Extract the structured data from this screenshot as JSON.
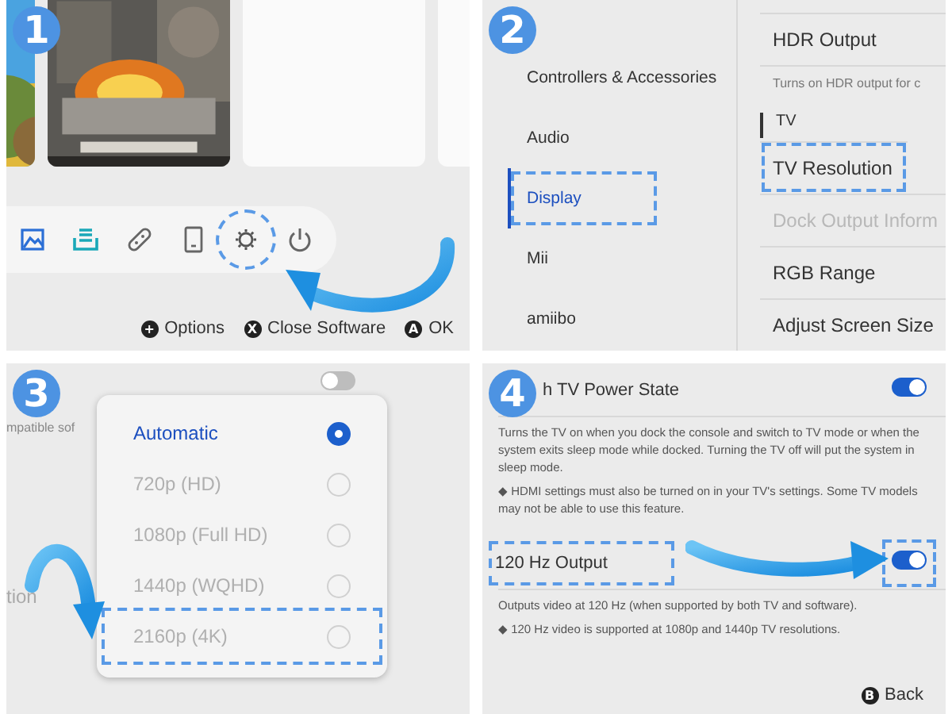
{
  "home_screen": {
    "badge": "1",
    "tiles": [
      {
        "kind": "picture"
      },
      {
        "kind": "picture"
      },
      {
        "kind": "empty"
      },
      {
        "kind": "empty"
      }
    ],
    "dock_icons": [
      {
        "kind": "album",
        "highlighted": false
      },
      {
        "kind": "shop",
        "highlighted": false
      },
      {
        "kind": "controllers",
        "highlighted": false
      },
      {
        "kind": "tablet",
        "highlighted": false
      },
      {
        "kind": "settings",
        "highlighted": true
      },
      {
        "kind": "power",
        "highlighted": false
      }
    ],
    "footer": [
      {
        "button": "+",
        "label": "Options"
      },
      {
        "button": "X",
        "label": "Close Software"
      },
      {
        "button": "A",
        "label": "OK"
      }
    ]
  },
  "settings_menu": {
    "badge": "2",
    "categories": [
      {
        "label": "Controllers & Accessories",
        "selected": false,
        "highlighted": false
      },
      {
        "label": "Audio",
        "selected": false,
        "highlighted": false
      },
      {
        "label": "Display",
        "selected": true,
        "highlighted": true
      },
      {
        "label": "Mii",
        "selected": false,
        "highlighted": false
      },
      {
        "label": "amiibo",
        "selected": false,
        "highlighted": false
      }
    ],
    "options": [
      {
        "kind": "item",
        "label": "HDR Output",
        "disabled": false,
        "highlighted": false
      },
      {
        "kind": "note",
        "label": "Turns on HDR output for c"
      },
      {
        "kind": "heading",
        "label": "TV"
      },
      {
        "kind": "item",
        "label": "TV Resolution",
        "disabled": false,
        "highlighted": true
      },
      {
        "kind": "item",
        "label": "Dock Output Inform",
        "disabled": true,
        "highlighted": false
      },
      {
        "kind": "item",
        "label": "RGB Range",
        "disabled": false,
        "highlighted": false
      },
      {
        "kind": "item",
        "label": "Adjust Screen Size",
        "disabled": false,
        "highlighted": false
      }
    ]
  },
  "resolution_dialog": {
    "badge": "3",
    "background_toggle": {
      "on": false
    },
    "background_texts": [
      "mpatible sof",
      "tion"
    ],
    "choices": [
      {
        "label": "Automatic",
        "selected": true,
        "highlighted": false
      },
      {
        "label": "720p (HD)",
        "selected": false,
        "highlighted": false
      },
      {
        "label": "1080p (Full HD)",
        "selected": false,
        "highlighted": false
      },
      {
        "label": "1440p (WQHD)",
        "selected": false,
        "highlighted": false
      },
      {
        "label": "2160p (4K)",
        "selected": false,
        "highlighted": true
      }
    ]
  },
  "tv_settings": {
    "badge": "4",
    "settings": [
      {
        "label": "h TV Power State",
        "on": true,
        "highlighted": false,
        "description": "Turns the TV on when you dock the console and switch to TV mode or when the system exits sleep mode while docked. Turning the TV off will put the system in sleep mode.",
        "note": "◆ HDMI settings must also be turned on in your TV's settings. Some TV models may not be able to use this feature."
      },
      {
        "label": "120 Hz Output",
        "on": true,
        "highlighted": true,
        "description": "Outputs video at 120 Hz (when supported by both TV and software).",
        "note": "◆ 120 Hz video is supported at 1080p and 1440p TV resolutions."
      }
    ],
    "footer": [
      {
        "button": "B",
        "label": "Back"
      }
    ]
  }
}
